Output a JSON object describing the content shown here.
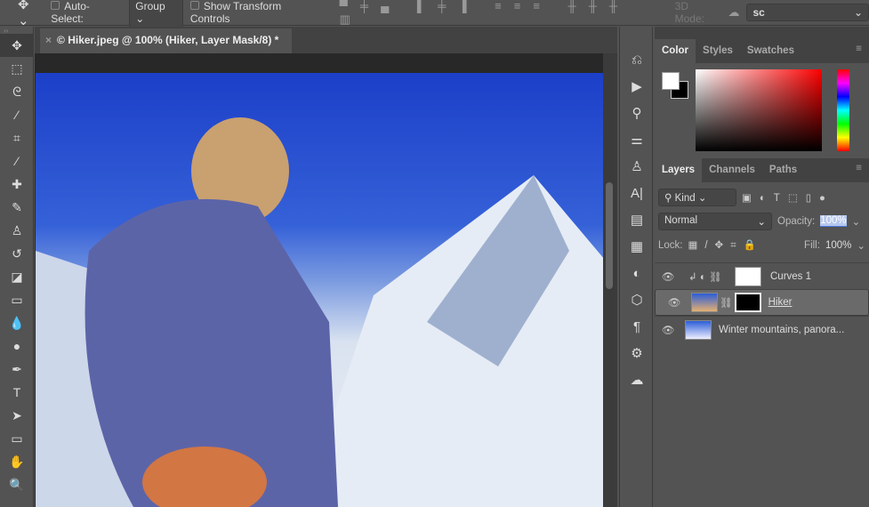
{
  "options": {
    "auto_select": "Auto-Select:",
    "group": "Group",
    "show_transform": "Show Transform Controls",
    "mode3d": "3D Mode:",
    "search_value": "sc"
  },
  "document": {
    "tab_title": "© Hiker.jpeg @ 100% (Hiker, Layer Mask/8) *",
    "close": "×"
  },
  "color_panel": {
    "tabs": [
      "Color",
      "Styles",
      "Swatches"
    ],
    "fg": "#ffffff",
    "bg": "#000000"
  },
  "layers_panel": {
    "tabs": [
      "Layers",
      "Channels",
      "Paths"
    ],
    "filter": "Kind",
    "blend_mode": "Normal",
    "opacity_label": "Opacity:",
    "opacity": "100%",
    "lock_label": "Lock:",
    "fill_label": "Fill:",
    "fill": "100%",
    "layers": [
      {
        "name": "Curves 1"
      },
      {
        "name": "Hiker"
      },
      {
        "name": "Winter mountains, panora..."
      }
    ]
  }
}
